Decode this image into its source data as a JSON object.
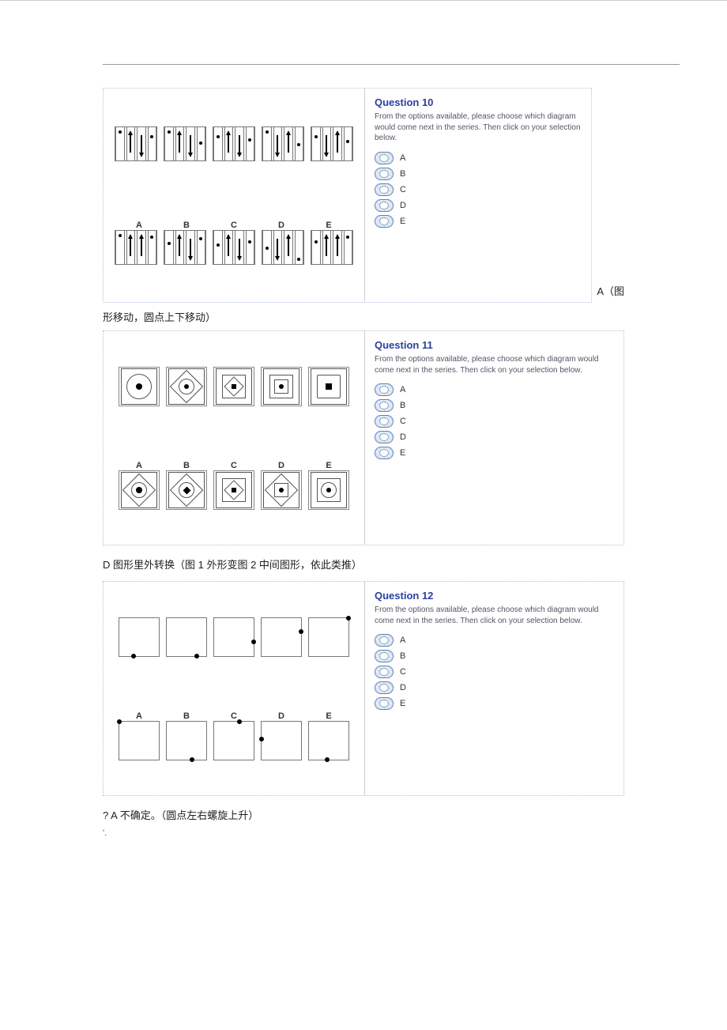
{
  "questions": [
    {
      "id": "q10",
      "title": "Question 10",
      "instruction": "From the options available, please choose which diagram would come next in the series. Then click on your selection below.",
      "options": [
        "A",
        "B",
        "C",
        "D",
        "E"
      ],
      "option_letters": [
        "A",
        "B",
        "C",
        "D",
        "E"
      ],
      "trailing_text": "A（图",
      "answer_note": "形移动，圆点上下移动）"
    },
    {
      "id": "q11",
      "title": "Question 11",
      "instruction": "From the options available, please choose which diagram would come next in the series. Then click on your selection below.",
      "options": [
        "A",
        "B",
        "C",
        "D",
        "E"
      ],
      "option_letters": [
        "A",
        "B",
        "C",
        "D",
        "E"
      ],
      "answer_note": "D  图形里外转换（图    1 外形变图   2 中间图形，依此类推）"
    },
    {
      "id": "q12",
      "title": "Question 12",
      "instruction": "From the options available, please choose which diagram would come next in the series. Then click on your selection below.",
      "options": [
        "A",
        "B",
        "C",
        "D",
        "E"
      ],
      "option_letters": [
        "A",
        "B",
        "C",
        "D",
        "E"
      ],
      "answer_note": "? A 不确定。（圆点左右螺旋上升）"
    }
  ],
  "footer_mark": "'."
}
